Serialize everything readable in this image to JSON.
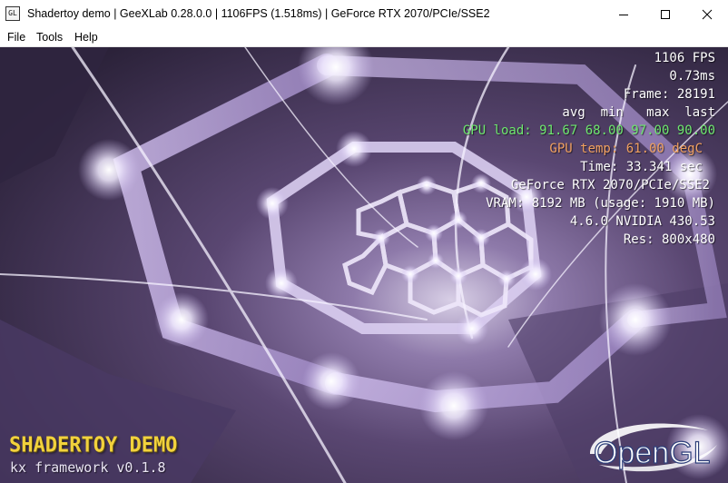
{
  "window": {
    "title": "Shadertoy demo | GeeXLab 0.28.0.0 | 1106FPS (1.518ms) | GeForce RTX 2070/PCIe/SSE2",
    "icon_text": "GL"
  },
  "menu": {
    "items": [
      "File",
      "Tools",
      "Help"
    ]
  },
  "overlay": {
    "fps": "1106 FPS",
    "frame_time": "0.73ms",
    "frame": "Frame: 28191",
    "stats_header": "avg  min   max  last",
    "gpu_load": "GPU load: 91.67 68.00 97.00 90.00",
    "gpu_temp": "GPU temp: 61.00 degC",
    "time": "Time: 33.341 sec",
    "renderer": "GeForce RTX 2070/PCIe/SSE2",
    "vram": "VRAM: 8192 MB (usage: 1910 MB)",
    "gl_version": "4.6.0 NVIDIA 430.53",
    "resolution": "Res: 800x480"
  },
  "demo": {
    "title": "SHADERTOY DEMO",
    "subtitle": "kx framework v0.1.8"
  },
  "logo": {
    "text": "OpenGL"
  },
  "colors": {
    "overlay_text": "#ffffff",
    "gpu_load": "#6ee86e",
    "gpu_temp": "#f0a060",
    "demo_title": "#f2d23c",
    "scene_bg": "#3a2f4e",
    "glow": "#f4efff"
  },
  "icons": {
    "minimize": "minimize-icon",
    "maximize": "maximize-icon",
    "close": "close-icon"
  }
}
